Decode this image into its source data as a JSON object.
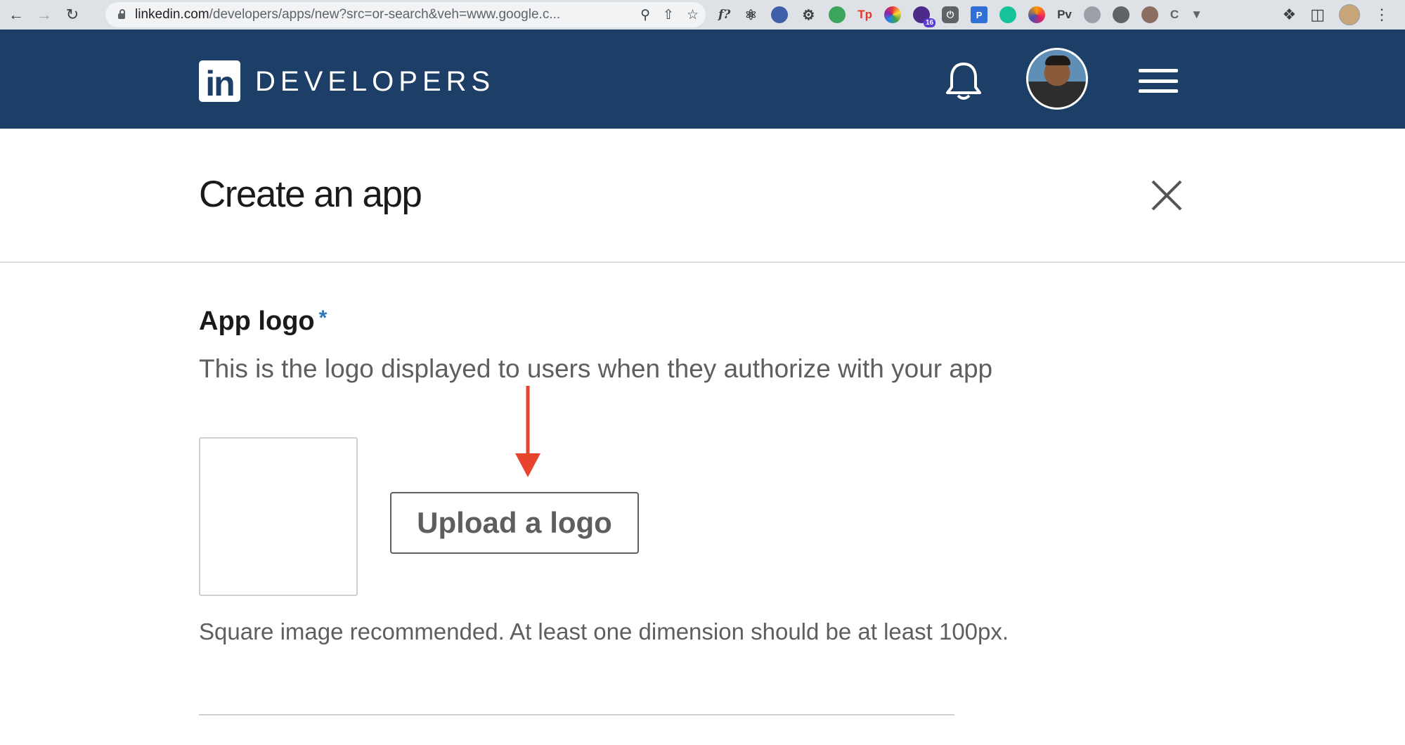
{
  "browser": {
    "url_host": "linkedin.com",
    "url_rest": "/developers/apps/new?src=or-search&veh=www.google.c...",
    "extension_badge": "16",
    "extension_labels": [
      "Tp",
      "P",
      "Pv",
      "C"
    ]
  },
  "header": {
    "logo_text": "in",
    "title": "DEVELOPERS"
  },
  "page": {
    "title": "Create an app"
  },
  "app_logo": {
    "label": "App logo",
    "required_mark": "*",
    "help": "This is the logo displayed to users when they authorize with your app",
    "upload_label": "Upload a logo",
    "hint": "Square image recommended. At least one dimension should be at least 100px."
  },
  "colors": {
    "header_bg": "#1d3e66",
    "required": "#2e77b8",
    "annotation_arrow": "#e8432d"
  }
}
